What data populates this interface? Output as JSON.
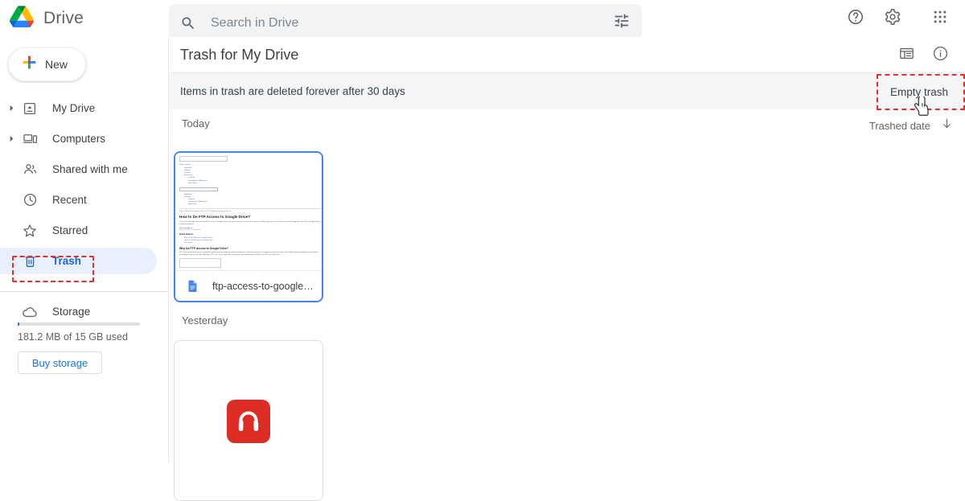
{
  "app": {
    "brand_name": "Drive",
    "logo_icon": "google-drive-logo"
  },
  "search": {
    "placeholder": "Search in Drive",
    "value": "",
    "icon": "search-icon",
    "filter_icon": "tune-filter-icon"
  },
  "topbar_actions": [
    {
      "name": "help",
      "icon": "help-circle-icon",
      "label": "Support"
    },
    {
      "name": "settings",
      "icon": "gear-icon",
      "label": "Settings"
    },
    {
      "name": "apps",
      "icon": "apps-grid-icon",
      "label": "Google apps"
    }
  ],
  "sidebar": {
    "new_button": {
      "label": "New",
      "icon": "plus-icon"
    },
    "items": [
      {
        "label": "My Drive",
        "icon": "my-drive-icon",
        "expandable": true,
        "active": false
      },
      {
        "label": "Computers",
        "icon": "computers-icon",
        "expandable": true,
        "active": false
      },
      {
        "label": "Shared with me",
        "icon": "shared-people-icon",
        "expandable": false,
        "active": false
      },
      {
        "label": "Recent",
        "icon": "clock-icon",
        "expandable": false,
        "active": false
      },
      {
        "label": "Starred",
        "icon": "star-icon",
        "expandable": false,
        "active": false
      },
      {
        "label": "Trash",
        "icon": "trash-icon",
        "expandable": false,
        "active": true
      }
    ],
    "storage": {
      "label": "Storage",
      "icon": "cloud-icon",
      "usage_text": "181.2 MB of 15 GB used",
      "used_percent": 1.2,
      "buy_button_label": "Buy storage"
    }
  },
  "main": {
    "page_title": "Trash for My Drive",
    "header_actions": [
      {
        "name": "list-view",
        "icon": "list-view-icon"
      },
      {
        "name": "details",
        "icon": "info-circle-icon"
      }
    ],
    "banner": {
      "text": "Items in trash are deleted forever after 30 days",
      "action_label": "Empty trash"
    },
    "sort": {
      "label": "Trashed date",
      "direction_icon": "arrow-down-icon"
    },
    "groups": [
      {
        "label": "Today",
        "files": [
          {
            "name": "ftp-access-to-google-driv…",
            "type": "document",
            "icon": "google-docs-icon",
            "selected": true,
            "preview": {
              "top_link": "Skip to content",
              "nav_items": [
                "Download",
                "Features",
                "Reviews",
                "Resources"
              ],
              "nav_subitems": [
                "Tutorials",
                "Comparison & Alternative",
                "Help Center"
              ],
              "breadcrumb": "Home  ›  MultCloud Support  ›  How to Do FTP Access to Google Drive?",
              "title": "How to Do FTP Access to Google Drive?",
              "intro": "This article will guide you how to do FTP access to Google Drive in an easier and more convenient manner. It will help you save a lot of time when transferring files from FTP to Google Drive in an efficient method.",
              "author_line": "Written by Allison",
              "date_line": "June 10, 2021 | 5 mins read",
              "quick_search_heading": "Quick Search:",
              "quick_search_links": [
                "Why Do FTP Access to Google Drive?",
                "How Do I FTP Access to Google Drive?",
                "Conclusion"
              ],
              "section_heading": "Why Do FTP Access to Google Drive?",
              "section_body": "FTP (File Transfer Protocol) is a standard network protocol used to transfer files between a client and server on a computer network. It is one of the oldest protocols available in use and the most popular way to move files. Although FTP is one of the oldest file transfer methods, many people still like to use FTP to transfer files."
            }
          }
        ]
      },
      {
        "label": "Yesterday",
        "files": [
          {
            "name": "",
            "type": "audio",
            "icon": "headphones-icon",
            "icon_color": "#dd2c24",
            "selected": false
          }
        ]
      }
    ]
  },
  "cursor": {
    "icon": "pointing-hand-cursor"
  },
  "colors": {
    "accent": "#1a73e8",
    "active_pill": "#e8f0fe",
    "highlight_outline": "#ea2d2d",
    "banner_bg": "#f5f6f7",
    "search_bg": "#f1f3f4",
    "card_selected_border": "#4285f4"
  }
}
